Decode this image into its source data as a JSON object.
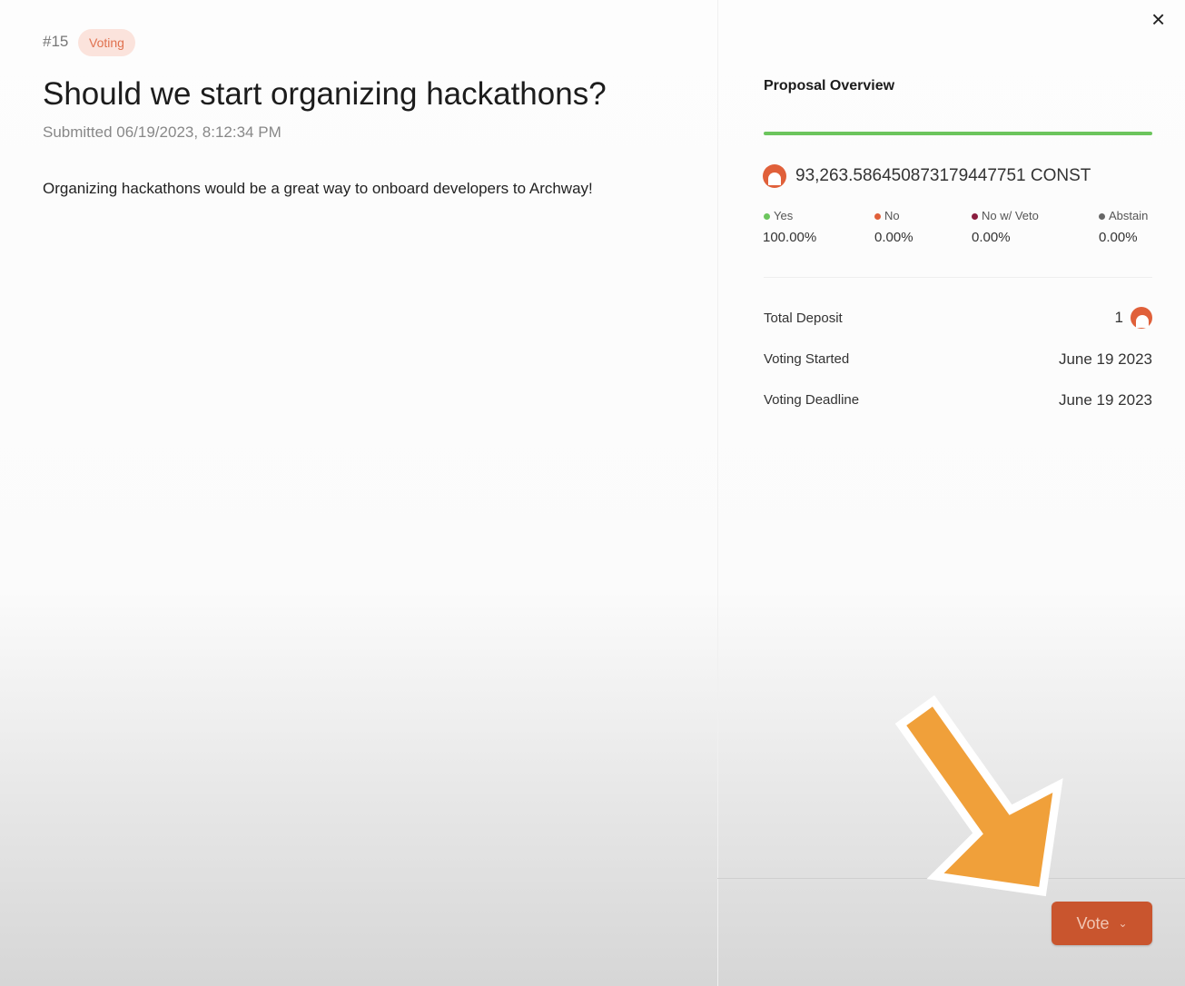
{
  "proposal": {
    "number": "#15",
    "status": "Voting",
    "title": "Should we start organizing hackathons?",
    "submitted": "Submitted 06/19/2023, 8:12:34 PM",
    "description": "Organizing hackathons would be a great way to onboard developers to Archway!"
  },
  "overview": {
    "title": "Proposal Overview",
    "amount": "93,263.586450873179447751 CONST",
    "options": [
      {
        "label": "Yes",
        "pct": "100.00%",
        "color": "#6cc55d"
      },
      {
        "label": "No",
        "pct": "0.00%",
        "color": "#e0603a"
      },
      {
        "label": "No w/ Veto",
        "pct": "0.00%",
        "color": "#8b1e3f"
      },
      {
        "label": "Abstain",
        "pct": "0.00%",
        "color": "#666666"
      }
    ],
    "details": [
      {
        "label": "Total Deposit",
        "value": "1"
      },
      {
        "label": "Voting Started",
        "value": "June 19 2023"
      },
      {
        "label": "Voting Deadline",
        "value": "June 19 2023"
      }
    ]
  },
  "vote_button": "Vote",
  "close_icon": "×"
}
